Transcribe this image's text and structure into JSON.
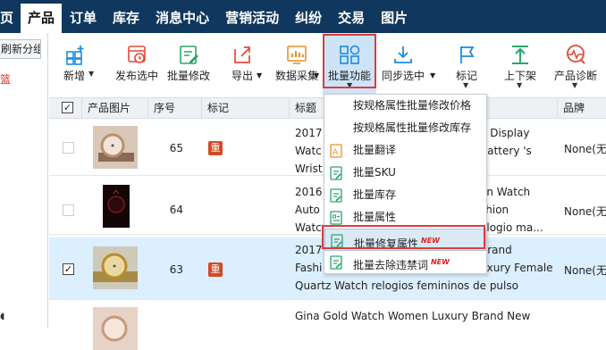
{
  "nav": {
    "items": [
      "页",
      "产品",
      "订单",
      "库存",
      "消息中心",
      "营销活动",
      "纠纷",
      "交易",
      "图片"
    ],
    "active_index": 1
  },
  "left": {
    "new_group_button": "刷新分组",
    "red_text": "篮"
  },
  "toolbar": {
    "buttons": [
      {
        "label": "新增",
        "icon": "add-grid-icon",
        "has_caret": true
      },
      {
        "label": "发布选中",
        "icon": "publish-clock-icon",
        "has_caret": true
      },
      {
        "label": "批量修改",
        "icon": "batch-edit-icon",
        "has_caret": false
      },
      {
        "label": "导出",
        "icon": "export-icon",
        "has_caret": true
      },
      {
        "label": "数据采集",
        "icon": "data-collect-icon",
        "has_caret": true
      },
      {
        "label": "批量功能",
        "icon": "batch-functions-icon",
        "has_caret": true
      },
      {
        "label": "同步选中",
        "icon": "sync-download-icon",
        "has_caret": true
      },
      {
        "label": "标记",
        "icon": "flag-icon",
        "has_caret": true
      },
      {
        "label": "上下架",
        "icon": "up-down-shelf-icon",
        "has_caret": true
      },
      {
        "label": "产品诊断",
        "icon": "product-diagnosis-icon",
        "has_caret": true
      }
    ],
    "highlighted_index": 5,
    "accent_color": "#1a8ce0",
    "highlight_border_color": "#e03a3a"
  },
  "table": {
    "headers": [
      "产品图片",
      "序号",
      "标记",
      "标题",
      "品牌"
    ],
    "rows": [
      {
        "num": "65",
        "badge": "重",
        "title_lines": [
          "2017",
          "Watc",
          "Wrist"
        ],
        "title_right": [
          "e Display",
          "Battery 's",
          ""
        ],
        "brand": "None(无",
        "checked": false,
        "thumb": "watch-rose"
      },
      {
        "num": "64",
        "badge": "",
        "title_lines": [
          "2016",
          "Auto",
          "Watc"
        ],
        "title_right": [
          "en Watch",
          "shion",
          "elogio ma..."
        ],
        "brand": "None(无",
        "checked": false,
        "thumb": "watch-dark"
      },
      {
        "num": "63",
        "badge": "重",
        "title_lines": [
          "2017",
          "Fashi",
          "Quartz Watch relogios femininos de pulso"
        ],
        "title_right": [
          "Brand",
          "uxury Female",
          ""
        ],
        "brand": "None(无",
        "checked": true,
        "thumb": "watch-gold"
      },
      {
        "num": "",
        "badge": "",
        "title_lines": [
          "Gina Gold Watch Women Luxury Brand New"
        ],
        "title_right": [
          ""
        ],
        "brand": "",
        "checked": false,
        "thumb": "watch-rose2"
      }
    ]
  },
  "dropdown": {
    "items": [
      {
        "label": "按规格属性批量修改价格",
        "icon": "",
        "new": false
      },
      {
        "label": "按规格属性批量修改库存",
        "icon": "",
        "new": false
      },
      {
        "label": "批量翻译",
        "icon": "translate-icon",
        "new": false
      },
      {
        "label": "批量SKU",
        "icon": "sku-doc-icon",
        "new": false
      },
      {
        "label": "批量库存",
        "icon": "stock-doc-icon",
        "new": false
      },
      {
        "label": "批量属性",
        "icon": "attribute-doc-icon",
        "new": false
      },
      {
        "label": "批量修复属性",
        "icon": "repair-attribute-icon",
        "new": true
      },
      {
        "label": "批量去除违禁词",
        "icon": "remove-banned-words-icon",
        "new": true
      }
    ],
    "hover_index": 6,
    "new_tag": "NEW"
  }
}
